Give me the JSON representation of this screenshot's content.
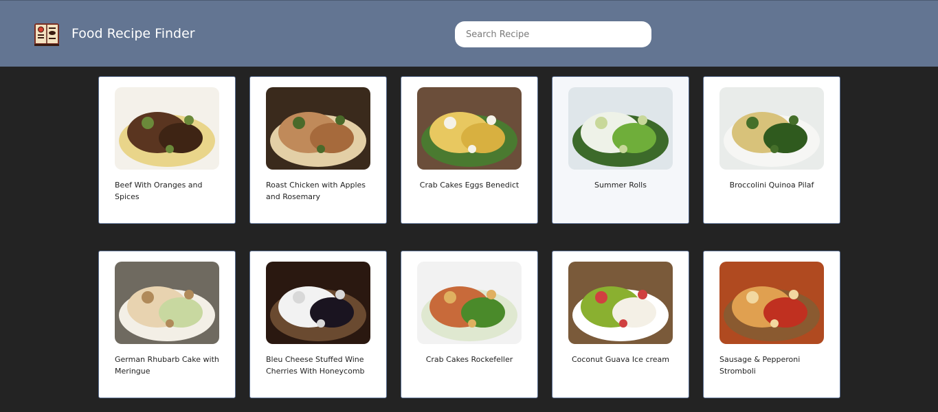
{
  "header": {
    "title": "Food Recipe Finder",
    "logo_icon": "recipe-book-icon"
  },
  "search": {
    "placeholder": "Search Recipe",
    "value": ""
  },
  "recipes": [
    {
      "title": "Beef With Oranges and Spices",
      "palette": [
        "#f4f1ea",
        "#5a3520",
        "#3e2414",
        "#6b8a3a",
        "#e9d58a"
      ]
    },
    {
      "title": "Roast Chicken with Apples and Rosemary",
      "palette": [
        "#3a2a1c",
        "#c08a5a",
        "#a66a3c",
        "#4a6a2a",
        "#e3cfa6"
      ]
    },
    {
      "title": "Crab Cakes Eggs Benedict",
      "palette": [
        "#6b4e3a",
        "#e8c860",
        "#d8b040",
        "#f5f2e8",
        "#4a7a30"
      ]
    },
    {
      "title": "Summer Rolls",
      "palette": [
        "#dfe6ea",
        "#eef2e8",
        "#6fae3a",
        "#c8d89a",
        "#3c6a2a"
      ]
    },
    {
      "title": "Broccolini Quinoa Pilaf",
      "palette": [
        "#e9ecea",
        "#d8c27a",
        "#2f5a1e",
        "#456f2a",
        "#f6f6f4"
      ]
    },
    {
      "title": "German Rhubarb Cake with Meringue",
      "palette": [
        "#6f6a60",
        "#e8d3b0",
        "#c8d8a0",
        "#b08a5a",
        "#f3efe6"
      ]
    },
    {
      "title": "Bleu Cheese Stuffed Wine Cherries With Honeycomb",
      "palette": [
        "#2a1810",
        "#f2f2f2",
        "#1a1420",
        "#d8d8d8",
        "#6a4a30"
      ]
    },
    {
      "title": "Crab Cakes Rockefeller",
      "palette": [
        "#f2f2f2",
        "#c86a3a",
        "#4a8a2a",
        "#e0b060",
        "#dfe8d0"
      ]
    },
    {
      "title": "Coconut Guava Ice cream",
      "palette": [
        "#7a5a3a",
        "#8ab030",
        "#f4f0e6",
        "#d04040",
        "#ffffff"
      ]
    },
    {
      "title": "Sausage & Pepperoni Stromboli",
      "palette": [
        "#b04a20",
        "#e0a050",
        "#c03020",
        "#f2d8a0",
        "#8a5a30"
      ]
    }
  ],
  "layout_state": {
    "hovered_recipe_index": 3
  }
}
